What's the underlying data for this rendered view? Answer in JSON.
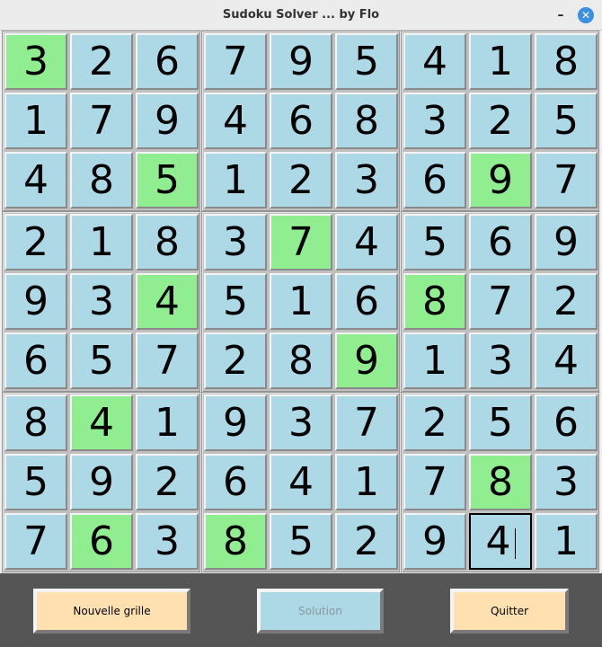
{
  "window": {
    "title": "Sudoku Solver ... by Flo",
    "minimize_label": "–",
    "close_label": "✕"
  },
  "colors": {
    "cell": "#add8e6",
    "given": "#90ee90",
    "button_orange": "#ffe0b0",
    "button_blue": "#add8e6",
    "disabled_text": "#8a9aa0",
    "background": "#555555"
  },
  "grid": [
    [
      "3",
      "2",
      "6",
      "7",
      "9",
      "5",
      "4",
      "1",
      "8"
    ],
    [
      "1",
      "7",
      "9",
      "4",
      "6",
      "8",
      "3",
      "2",
      "5"
    ],
    [
      "4",
      "8",
      "5",
      "1",
      "2",
      "3",
      "6",
      "9",
      "7"
    ],
    [
      "2",
      "1",
      "8",
      "3",
      "7",
      "4",
      "5",
      "6",
      "9"
    ],
    [
      "9",
      "3",
      "4",
      "5",
      "1",
      "6",
      "8",
      "7",
      "2"
    ],
    [
      "6",
      "5",
      "7",
      "2",
      "8",
      "9",
      "1",
      "3",
      "4"
    ],
    [
      "8",
      "4",
      "1",
      "9",
      "3",
      "7",
      "2",
      "5",
      "6"
    ],
    [
      "5",
      "9",
      "2",
      "6",
      "4",
      "1",
      "7",
      "8",
      "3"
    ],
    [
      "7",
      "6",
      "3",
      "8",
      "5",
      "2",
      "9",
      "4",
      "1"
    ]
  ],
  "given_cells": [
    [
      0,
      0
    ],
    [
      2,
      2
    ],
    [
      2,
      7
    ],
    [
      3,
      4
    ],
    [
      4,
      2
    ],
    [
      4,
      6
    ],
    [
      5,
      5
    ],
    [
      6,
      1
    ],
    [
      7,
      7
    ],
    [
      8,
      1
    ],
    [
      8,
      3
    ]
  ],
  "focused_cell": [
    8,
    7
  ],
  "buttons": {
    "new_grid": {
      "label": "Nouvelle grille",
      "enabled": true
    },
    "solution": {
      "label": "Solution",
      "enabled": false
    },
    "quit": {
      "label": "Quitter",
      "enabled": true
    }
  }
}
